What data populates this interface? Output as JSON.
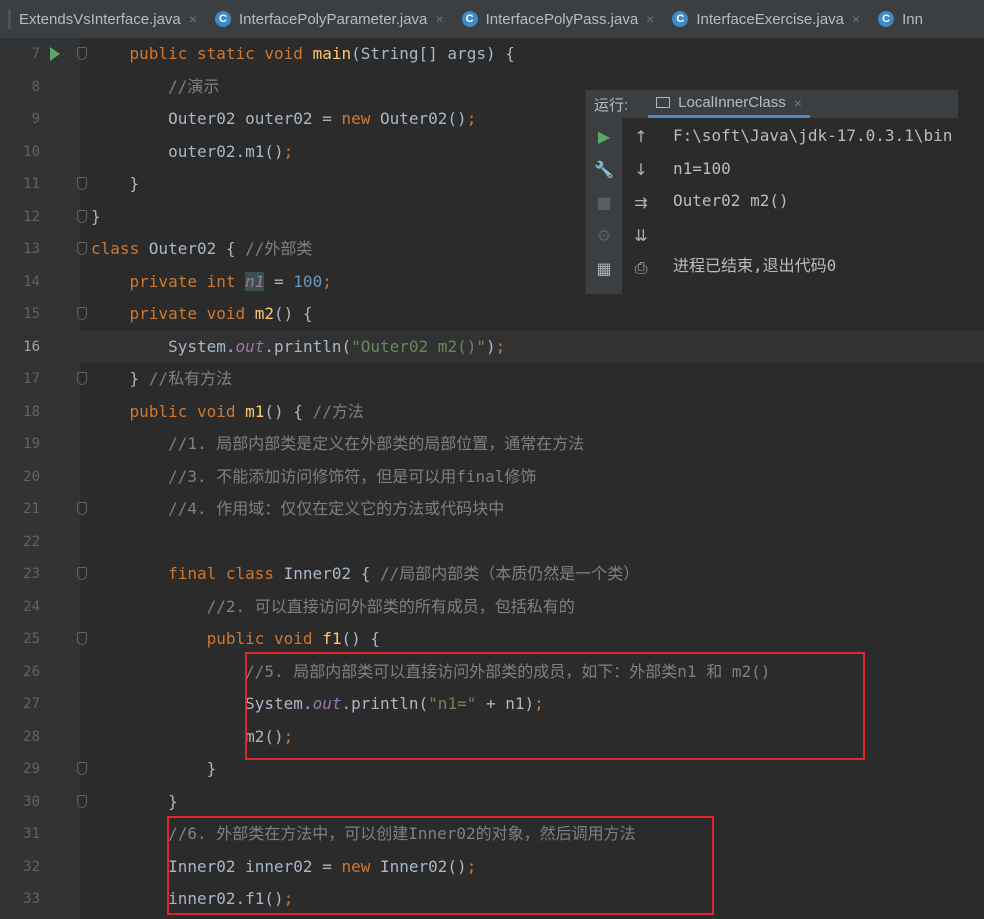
{
  "tabs": [
    {
      "label": "ExtendsVsInterface.java",
      "icon": "class-icon"
    },
    {
      "label": "InterfacePolyParameter.java",
      "icon": "class-icon"
    },
    {
      "label": "InterfacePolyPass.java",
      "icon": "class-icon"
    },
    {
      "label": "InterfaceExercise.java",
      "icon": "class-icon"
    },
    {
      "label": "Inn",
      "icon": "class-icon"
    }
  ],
  "tab_close_glyph": "×",
  "tab_icon_letter": "C",
  "current_line": 16,
  "lines": [
    {
      "n": 7,
      "segs": [
        [
          "    ",
          ""
        ],
        [
          "public static void ",
          "kw"
        ],
        [
          "main",
          "fn"
        ],
        [
          "(String[] args) {",
          ""
        ]
      ]
    },
    {
      "n": 8,
      "segs": [
        [
          "        ",
          ""
        ],
        [
          "//演示",
          "cm"
        ]
      ]
    },
    {
      "n": 9,
      "segs": [
        [
          "        Outer02 outer02 = ",
          ""
        ],
        [
          "new ",
          "kw"
        ],
        [
          "Outer02()",
          ""
        ],
        [
          ";",
          "kw"
        ]
      ]
    },
    {
      "n": 10,
      "segs": [
        [
          "        outer02.m1()",
          ""
        ],
        [
          ";",
          "kw"
        ]
      ]
    },
    {
      "n": 11,
      "segs": [
        [
          "    }",
          ""
        ]
      ]
    },
    {
      "n": 12,
      "segs": [
        [
          "}",
          ""
        ]
      ]
    },
    {
      "n": 13,
      "segs": [
        [
          "class ",
          "kw"
        ],
        [
          "Outer02 { ",
          ""
        ],
        [
          "//外部类",
          "cm"
        ]
      ]
    },
    {
      "n": 14,
      "segs": [
        [
          "    ",
          ""
        ],
        [
          "private int ",
          "kw"
        ],
        [
          "n1",
          "field hl"
        ],
        [
          " = ",
          ""
        ],
        [
          "100",
          "num"
        ],
        [
          ";",
          "kw"
        ]
      ]
    },
    {
      "n": 15,
      "segs": [
        [
          "    ",
          ""
        ],
        [
          "private void ",
          "kw"
        ],
        [
          "m2",
          "fn"
        ],
        [
          "() {",
          ""
        ]
      ]
    },
    {
      "n": 16,
      "segs": [
        [
          "        System.",
          ""
        ],
        [
          "out",
          "field"
        ],
        [
          ".println(",
          ""
        ],
        [
          "\"Outer02 m2()\"",
          "str"
        ],
        [
          ")",
          ""
        ],
        [
          ";",
          "kw"
        ]
      ]
    },
    {
      "n": 17,
      "segs": [
        [
          "    } ",
          ""
        ],
        [
          "//私有方法",
          "cm"
        ]
      ]
    },
    {
      "n": 18,
      "segs": [
        [
          "    ",
          ""
        ],
        [
          "public void ",
          "kw"
        ],
        [
          "m1",
          "fn"
        ],
        [
          "() { ",
          ""
        ],
        [
          "//方法",
          "cm"
        ]
      ]
    },
    {
      "n": 19,
      "segs": [
        [
          "        ",
          ""
        ],
        [
          "//1. 局部内部类是定义在外部类的局部位置，通常在方法",
          "cm"
        ]
      ]
    },
    {
      "n": 20,
      "segs": [
        [
          "        ",
          ""
        ],
        [
          "//3. 不能添加访问修饰符，但是可以用final修饰",
          "cm"
        ]
      ]
    },
    {
      "n": 21,
      "segs": [
        [
          "        ",
          ""
        ],
        [
          "//4. 作用域：仅仅在定义它的方法或代码块中",
          "cm"
        ]
      ]
    },
    {
      "n": 22,
      "segs": []
    },
    {
      "n": 23,
      "segs": [
        [
          "        ",
          ""
        ],
        [
          "final class ",
          "kw"
        ],
        [
          "Inner02 { ",
          ""
        ],
        [
          "//局部内部类（本质仍然是一个类）",
          "cm"
        ]
      ]
    },
    {
      "n": 24,
      "segs": [
        [
          "            ",
          ""
        ],
        [
          "//2. 可以直接访问外部类的所有成员，包括私有的",
          "cm"
        ]
      ]
    },
    {
      "n": 25,
      "segs": [
        [
          "            ",
          ""
        ],
        [
          "public void ",
          "kw"
        ],
        [
          "f1",
          "fn"
        ],
        [
          "() {",
          ""
        ]
      ]
    },
    {
      "n": 26,
      "segs": [
        [
          "                ",
          ""
        ],
        [
          "//5. 局部内部类可以直接访问外部类的成员，如下：外部类n1 和 m2()",
          "cm"
        ]
      ]
    },
    {
      "n": 27,
      "segs": [
        [
          "                System.",
          ""
        ],
        [
          "out",
          "field"
        ],
        [
          ".println(",
          ""
        ],
        [
          "\"n1=\"",
          "str"
        ],
        [
          " + n1)",
          ""
        ],
        [
          ";",
          "kw"
        ]
      ]
    },
    {
      "n": 28,
      "segs": [
        [
          "                m2()",
          ""
        ],
        [
          ";",
          "kw"
        ]
      ]
    },
    {
      "n": 29,
      "segs": [
        [
          "            }",
          ""
        ]
      ]
    },
    {
      "n": 30,
      "segs": [
        [
          "        }",
          ""
        ]
      ]
    },
    {
      "n": 31,
      "segs": [
        [
          "        ",
          ""
        ],
        [
          "//6. 外部类在方法中，可以创建Inner02的对象，然后调用方法",
          "cm"
        ]
      ]
    },
    {
      "n": 32,
      "segs": [
        [
          "        Inner02 inner02 = ",
          ""
        ],
        [
          "new ",
          "kw"
        ],
        [
          "Inner02()",
          ""
        ],
        [
          ";",
          "kw"
        ]
      ]
    },
    {
      "n": 33,
      "segs": [
        [
          "        inner02.f1()",
          ""
        ],
        [
          ";",
          "kw"
        ]
      ]
    }
  ],
  "run_panel": {
    "label": "运行:",
    "tab": "LocalInnerClass",
    "close_glyph": "×",
    "output": [
      "F:\\soft\\Java\\jdk-17.0.3.1\\bin",
      "n1=100",
      "Outer02 m2()",
      "",
      "进程已结束,退出代码0"
    ],
    "toolbar_left": [
      {
        "name": "rerun-icon",
        "glyph": "▶",
        "color": "#59a869"
      },
      {
        "name": "wrench-icon",
        "glyph": "🔧",
        "color": "#afb1b3"
      },
      {
        "name": "stop-icon",
        "glyph": "■",
        "color": "#5b5d5f"
      },
      {
        "name": "debug-gear-icon",
        "glyph": "⚙",
        "color": "#5b5d5f"
      },
      {
        "name": "layout-icon",
        "glyph": "▦",
        "color": "#afb1b3"
      }
    ],
    "toolbar_right": [
      {
        "name": "arrow-up-icon",
        "glyph": "↑",
        "color": "#afb1b3"
      },
      {
        "name": "arrow-down-icon",
        "glyph": "↓",
        "color": "#afb1b3"
      },
      {
        "name": "soft-wrap-icon",
        "glyph": "⇉",
        "color": "#afb1b3"
      },
      {
        "name": "scroll-to-end-icon",
        "glyph": "⇊",
        "color": "#afb1b3"
      },
      {
        "name": "print-icon",
        "glyph": "⎙",
        "color": "#afb1b3"
      }
    ]
  },
  "colors": {
    "keyword": "#cc7832",
    "comment": "#808080",
    "method": "#ffc66d",
    "number": "#6897bb",
    "string": "#6a8759",
    "field": "#9876aa",
    "annotation_box": "#e0262b"
  }
}
